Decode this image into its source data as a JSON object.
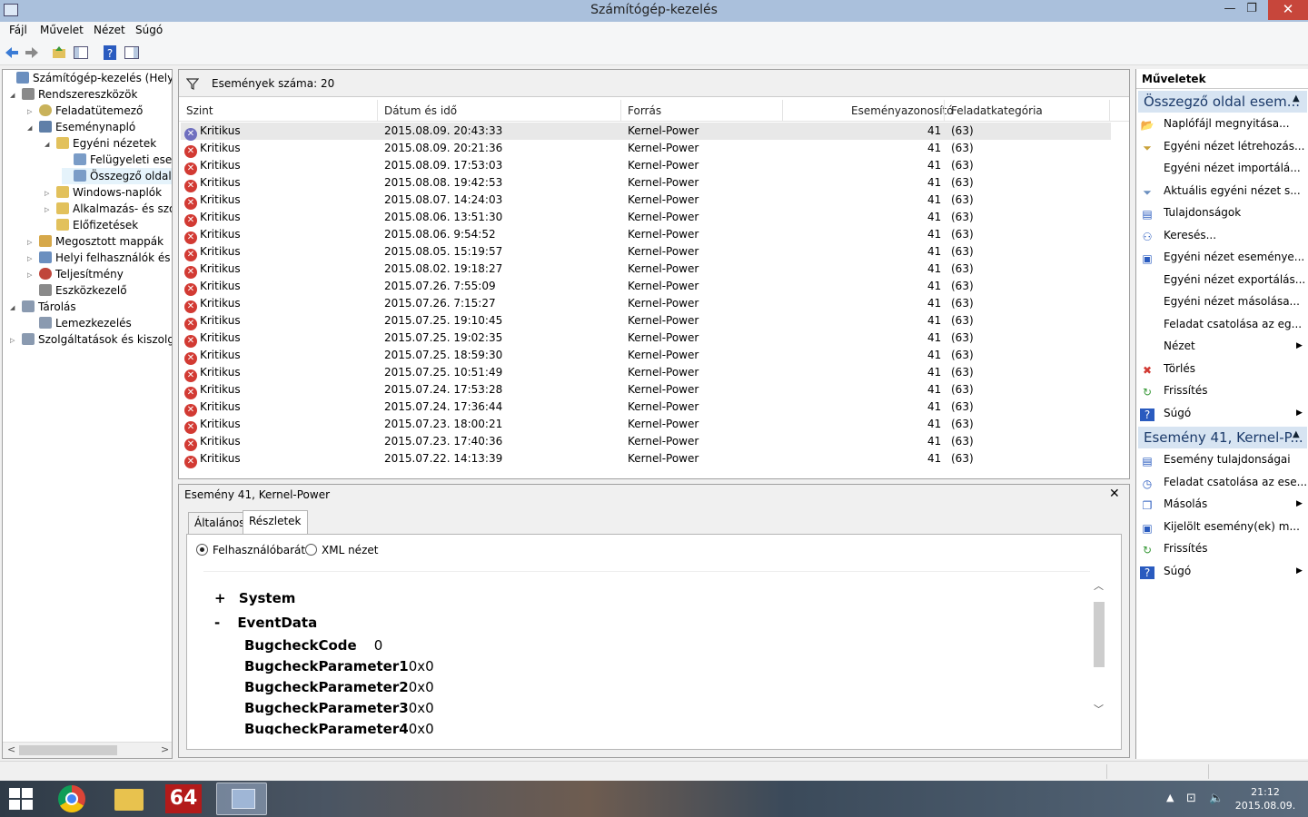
{
  "window": {
    "title": "Számítógép-kezelés",
    "min": "—",
    "max": "❐",
    "close": "✕"
  },
  "menu": [
    "Fájl",
    "Művelet",
    "Nézet",
    "Súgó"
  ],
  "tree": [
    {
      "label": "Számítógép-kezelés (Helyi)",
      "toggle": "",
      "icon_color": "#6b8fbf"
    },
    {
      "label": "Rendszereszközök",
      "toggle": "◢",
      "icon_color": "#8a8a8a"
    },
    {
      "label": "Feladatütemező",
      "toggle": "▷",
      "icon_color": "#c9b25a"
    },
    {
      "label": "Eseménynapló",
      "toggle": "◢",
      "icon_color": "#5f7fa8"
    },
    {
      "label": "Egyéni nézetek",
      "toggle": "◢",
      "icon_color": "#e2c15c"
    },
    {
      "label": "Felügyeleti esem",
      "toggle": "",
      "icon_color": "#7a9cc7"
    },
    {
      "label": "Összegző oldal e",
      "toggle": "",
      "icon_color": "#7a9cc7"
    },
    {
      "label": "Windows-naplók",
      "toggle": "▷",
      "icon_color": "#e2c15c"
    },
    {
      "label": "Alkalmazás- és szolg",
      "toggle": "▷",
      "icon_color": "#e2c15c"
    },
    {
      "label": "Előfizetések",
      "toggle": "",
      "icon_color": "#e2c15c"
    },
    {
      "label": "Megosztott mappák",
      "toggle": "▷",
      "icon_color": "#d6a84a"
    },
    {
      "label": "Helyi felhasználók és cs",
      "toggle": "▷",
      "icon_color": "#6b8fbf"
    },
    {
      "label": "Teljesítmény",
      "toggle": "▷",
      "icon_color": "#c0463b"
    },
    {
      "label": "Eszközkezelő",
      "toggle": "",
      "icon_color": "#8a8a8a"
    },
    {
      "label": "Tárolás",
      "toggle": "◢",
      "icon_color": "#8a9ab0"
    },
    {
      "label": "Lemezkezelés",
      "toggle": "",
      "icon_color": "#8a9ab0"
    },
    {
      "label": "Szolgáltatások és kiszolgáló",
      "toggle": "▷",
      "icon_color": "#8a9ab0"
    }
  ],
  "events_header": {
    "filter_icon": "filter-icon",
    "count_label": "Események száma: 20"
  },
  "columns": [
    "Szint",
    "Dátum és idő",
    "Forrás",
    "Eseményazonosító",
    "Feladatkategória"
  ],
  "rows": [
    {
      "level": "Kritikus",
      "date": "2015.08.09. 20:43:33",
      "source": "Kernel-Power",
      "id": "41",
      "cat": "(63)"
    },
    {
      "level": "Kritikus",
      "date": "2015.08.09. 20:21:36",
      "source": "Kernel-Power",
      "id": "41",
      "cat": "(63)"
    },
    {
      "level": "Kritikus",
      "date": "2015.08.09. 17:53:03",
      "source": "Kernel-Power",
      "id": "41",
      "cat": "(63)"
    },
    {
      "level": "Kritikus",
      "date": "2015.08.08. 19:42:53",
      "source": "Kernel-Power",
      "id": "41",
      "cat": "(63)"
    },
    {
      "level": "Kritikus",
      "date": "2015.08.07. 14:24:03",
      "source": "Kernel-Power",
      "id": "41",
      "cat": "(63)"
    },
    {
      "level": "Kritikus",
      "date": "2015.08.06. 13:51:30",
      "source": "Kernel-Power",
      "id": "41",
      "cat": "(63)"
    },
    {
      "level": "Kritikus",
      "date": "2015.08.06. 9:54:52",
      "source": "Kernel-Power",
      "id": "41",
      "cat": "(63)"
    },
    {
      "level": "Kritikus",
      "date": "2015.08.05. 15:19:57",
      "source": "Kernel-Power",
      "id": "41",
      "cat": "(63)"
    },
    {
      "level": "Kritikus",
      "date": "2015.08.02. 19:18:27",
      "source": "Kernel-Power",
      "id": "41",
      "cat": "(63)"
    },
    {
      "level": "Kritikus",
      "date": "2015.07.26. 7:55:09",
      "source": "Kernel-Power",
      "id": "41",
      "cat": "(63)"
    },
    {
      "level": "Kritikus",
      "date": "2015.07.26. 7:15:27",
      "source": "Kernel-Power",
      "id": "41",
      "cat": "(63)"
    },
    {
      "level": "Kritikus",
      "date": "2015.07.25. 19:10:45",
      "source": "Kernel-Power",
      "id": "41",
      "cat": "(63)"
    },
    {
      "level": "Kritikus",
      "date": "2015.07.25. 19:02:35",
      "source": "Kernel-Power",
      "id": "41",
      "cat": "(63)"
    },
    {
      "level": "Kritikus",
      "date": "2015.07.25. 18:59:30",
      "source": "Kernel-Power",
      "id": "41",
      "cat": "(63)"
    },
    {
      "level": "Kritikus",
      "date": "2015.07.25. 10:51:49",
      "source": "Kernel-Power",
      "id": "41",
      "cat": "(63)"
    },
    {
      "level": "Kritikus",
      "date": "2015.07.24. 17:53:28",
      "source": "Kernel-Power",
      "id": "41",
      "cat": "(63)"
    },
    {
      "level": "Kritikus",
      "date": "2015.07.24. 17:36:44",
      "source": "Kernel-Power",
      "id": "41",
      "cat": "(63)"
    },
    {
      "level": "Kritikus",
      "date": "2015.07.23. 18:00:21",
      "source": "Kernel-Power",
      "id": "41",
      "cat": "(63)"
    },
    {
      "level": "Kritikus",
      "date": "2015.07.23. 17:40:36",
      "source": "Kernel-Power",
      "id": "41",
      "cat": "(63)"
    },
    {
      "level": "Kritikus",
      "date": "2015.07.22. 14:13:39",
      "source": "Kernel-Power",
      "id": "41",
      "cat": "(63)"
    }
  ],
  "detail": {
    "title": "Esemény 41, Kernel-Power",
    "close": "✕",
    "tabs": [
      "Általános",
      "Részletek"
    ],
    "radio_friendly": "Felhasználóbarát",
    "radio_xml": "XML nézet",
    "system_toggle": "+",
    "system_label": "System",
    "eventdata_toggle": "-",
    "eventdata_label": "EventData",
    "fields": [
      {
        "name": "BugcheckCode",
        "value": "0"
      },
      {
        "name": "BugcheckParameter1",
        "value": "0x0"
      },
      {
        "name": "BugcheckParameter2",
        "value": "0x0"
      },
      {
        "name": "BugcheckParameter3",
        "value": "0x0"
      },
      {
        "name": "BugcheckParameter4",
        "value": "0x0"
      }
    ]
  },
  "actions": {
    "header": "Műveletek",
    "section1": "Összegző oldal esem...",
    "items1": [
      {
        "label": "Naplófájl megnyitása...",
        "icon": "open-folder-icon",
        "glyph": "📂",
        "sub": false
      },
      {
        "label": "Egyéni nézet létrehozás...",
        "icon": "filter-create-icon",
        "glyph": "⏷",
        "sub": false
      },
      {
        "label": "Egyéni nézet importálá...",
        "icon": "",
        "glyph": "",
        "sub": false
      },
      {
        "label": "Aktuális egyéni nézet s...",
        "icon": "filter-icon",
        "glyph": "⏷",
        "sub": false
      },
      {
        "label": "Tulajdonságok",
        "icon": "properties-icon",
        "glyph": "▤",
        "sub": false
      },
      {
        "label": "Keresés...",
        "icon": "binoculars-icon",
        "glyph": "⚇",
        "sub": false
      },
      {
        "label": "Egyéni nézet eseménye...",
        "icon": "save-icon",
        "glyph": "▣",
        "sub": false
      },
      {
        "label": "Egyéni nézet exportálás...",
        "icon": "",
        "glyph": "",
        "sub": false
      },
      {
        "label": "Egyéni nézet másolása...",
        "icon": "",
        "glyph": "",
        "sub": false
      },
      {
        "label": "Feladat csatolása az eg...",
        "icon": "",
        "glyph": "",
        "sub": false
      },
      {
        "label": "Nézet",
        "icon": "",
        "glyph": "",
        "sub": true
      },
      {
        "label": "Törlés",
        "icon": "delete-icon",
        "glyph": "✖",
        "sub": false
      },
      {
        "label": "Frissítés",
        "icon": "refresh-icon",
        "glyph": "↻",
        "sub": false
      },
      {
        "label": "Súgó",
        "icon": "help-icon",
        "glyph": "?",
        "sub": true
      }
    ],
    "section2": "Esemény 41, Kernel-P...",
    "items2": [
      {
        "label": "Esemény tulajdonságai",
        "icon": "event-properties-icon",
        "glyph": "▤",
        "sub": false
      },
      {
        "label": "Feladat csatolása az ese...",
        "icon": "task-icon",
        "glyph": "◷",
        "sub": false
      },
      {
        "label": "Másolás",
        "icon": "copy-icon",
        "glyph": "❐",
        "sub": true
      },
      {
        "label": "Kijelölt esemény(ek) m...",
        "icon": "save-icon",
        "glyph": "▣",
        "sub": false
      },
      {
        "label": "Frissítés",
        "icon": "refresh-icon",
        "glyph": "↻",
        "sub": false
      },
      {
        "label": "Súgó",
        "icon": "help-icon",
        "glyph": "?",
        "sub": true
      }
    ]
  },
  "taskbar": {
    "app_64": "64",
    "clock_time": "21:12",
    "clock_date": "2015.08.09."
  },
  "colors": {
    "critical": "#d23a33",
    "section_bg": "#d7e4f2",
    "close_btn": "#c7463b"
  }
}
